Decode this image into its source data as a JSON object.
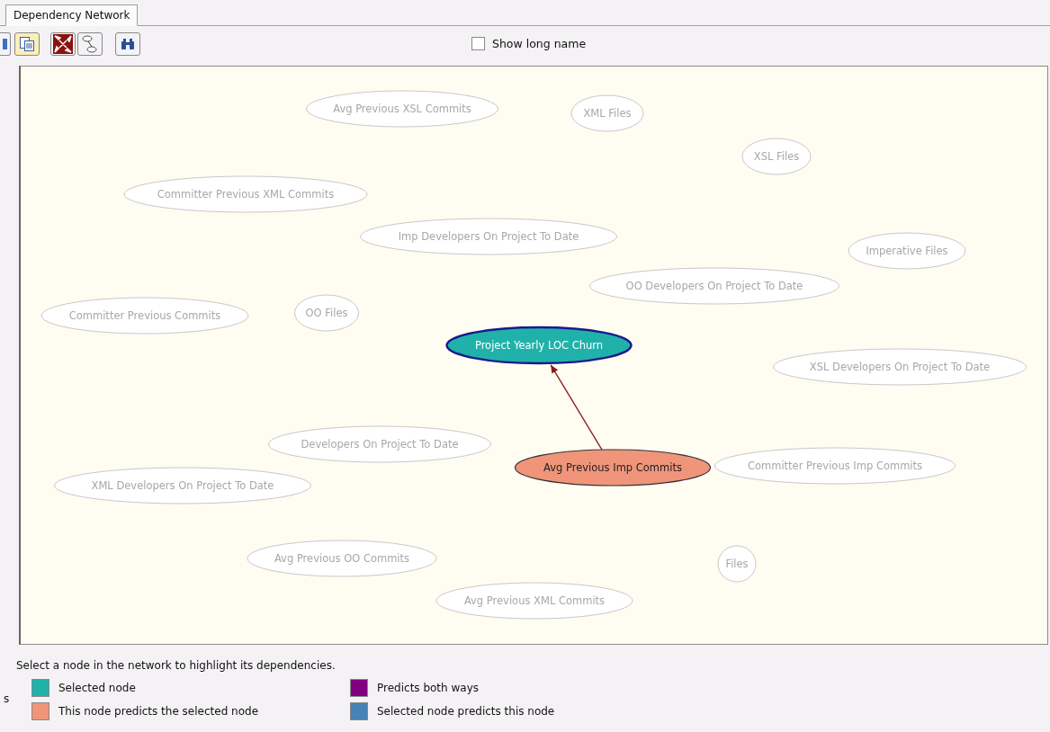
{
  "tabs": [
    {
      "label": "Dependency Network",
      "selected": true
    }
  ],
  "toolbar": {
    "show_long_name": {
      "label": "Show long name",
      "checked": false
    }
  },
  "network": {
    "nodes": [
      {
        "label": "Avg Previous XSL Commits",
        "kind": "plain"
      },
      {
        "label": "XML Files",
        "kind": "plain"
      },
      {
        "label": "XSL Files",
        "kind": "plain"
      },
      {
        "label": "Committer Previous XML Commits",
        "kind": "plain"
      },
      {
        "label": "Imp Developers On Project To Date",
        "kind": "plain"
      },
      {
        "label": "Imperative Files",
        "kind": "plain"
      },
      {
        "label": "OO Developers On Project To Date",
        "kind": "plain"
      },
      {
        "label": "Committer Previous Commits",
        "kind": "plain"
      },
      {
        "label": "OO Files",
        "kind": "plain"
      },
      {
        "label": "Project Yearly LOC Churn",
        "kind": "selected"
      },
      {
        "label": "XSL Developers On Project To Date",
        "kind": "plain"
      },
      {
        "label": "Developers On Project To Date",
        "kind": "plain"
      },
      {
        "label": "Avg Previous Imp Commits",
        "kind": "predicts"
      },
      {
        "label": "Committer Previous Imp Commits",
        "kind": "plain"
      },
      {
        "label": "XML Developers On Project To Date",
        "kind": "plain"
      },
      {
        "label": "Avg Previous OO Commits",
        "kind": "plain"
      },
      {
        "label": "Files",
        "kind": "plain"
      },
      {
        "label": "Avg Previous XML Commits",
        "kind": "plain"
      }
    ]
  },
  "hint": "Select a node in the network to highlight its dependencies.",
  "left_edge_text": "s",
  "legend": [
    {
      "label": "Selected node",
      "color": "#20b2aa"
    },
    {
      "label": "Predicts both ways",
      "color": "#800080"
    },
    {
      "label": "This node predicts the selected node",
      "color": "#f0957a"
    },
    {
      "label": "Selected node predicts this node",
      "color": "#4682b4"
    }
  ]
}
